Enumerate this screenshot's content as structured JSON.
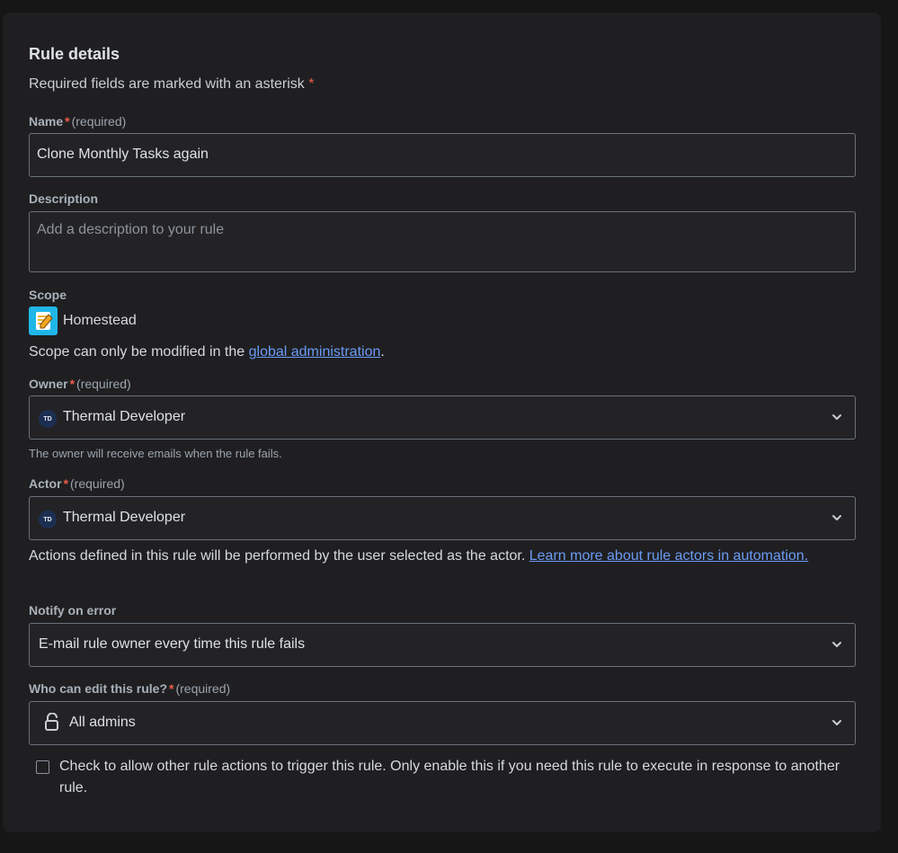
{
  "panel": {
    "title": "Rule details",
    "required_note": "Required fields are marked with an asterisk",
    "required_star": "*"
  },
  "name": {
    "label": "Name",
    "star": "*",
    "req": "(required)",
    "value": "Clone Monthly Tasks again"
  },
  "description": {
    "label": "Description",
    "placeholder": "Add a description to your rule"
  },
  "scope": {
    "label": "Scope",
    "project": "Homestead",
    "project_icon": "notepad-icon",
    "note_prefix": "Scope can only be modified in the",
    "note_link": "global administration",
    "note_suffix": "."
  },
  "owner": {
    "label": "Owner",
    "star": "*",
    "req": "(required)",
    "avatar": "TD",
    "value": "Thermal Developer",
    "helper": "The owner will receive emails when the rule fails."
  },
  "actor": {
    "label": "Actor",
    "star": "*",
    "req": "(required)",
    "avatar": "TD",
    "value": "Thermal Developer",
    "helper_text": "Actions defined in this rule will be performed by the user selected as the actor.",
    "helper_link": "Learn more about rule actors in automation."
  },
  "notify": {
    "label": "Notify on error",
    "value": "E-mail rule owner every time this rule fails"
  },
  "edit": {
    "label": "Who can edit this rule?",
    "star": "*",
    "req": "(required)",
    "icon": "unlock-icon",
    "value": "All admins"
  },
  "trigger_checkbox": {
    "checked": false,
    "label": "Check to allow other rule actions to trigger this rule. Only enable this if you need this rule to execute in response to another rule."
  },
  "colors": {
    "background": "#1f1f21",
    "field_border": "#6b717a",
    "link": "#6b9bf5",
    "required_star": "#ef5c48"
  }
}
